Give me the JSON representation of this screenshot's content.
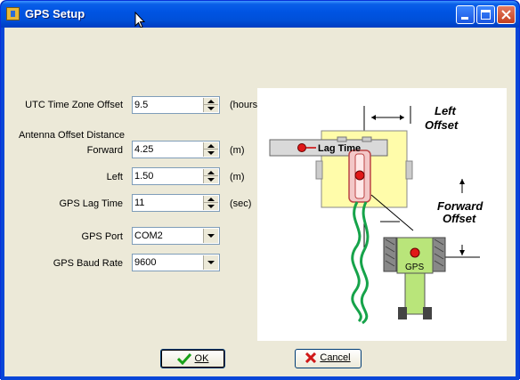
{
  "window": {
    "title": "GPS Setup",
    "minimize_glyph": "_",
    "maximize_glyph": "□",
    "close_glyph": "✕"
  },
  "form": {
    "utc_label": "UTC Time Zone Offset",
    "utc_value": "9.5",
    "utc_unit": "(hours)",
    "antenna_heading": "Antenna Offset Distance",
    "forward_label": "Forward",
    "forward_value": "4.25",
    "forward_unit": "(m)",
    "left_label": "Left",
    "left_value": "1.50",
    "left_unit": "(m)",
    "lag_label": "GPS Lag Time",
    "lag_value": "11",
    "lag_unit": "(sec)",
    "port_label": "GPS Port",
    "port_value": "COM2",
    "baud_label": "GPS Baud Rate",
    "baud_value": "9600"
  },
  "diagram": {
    "left_offset_line1": "Left",
    "left_offset_line2": "Offset",
    "lag_time": "Lag Time",
    "forward_offset_line1": "Forward",
    "forward_offset_line2": "Offset",
    "gps": "GPS"
  },
  "buttons": {
    "ok": "OK",
    "cancel": "Cancel"
  },
  "icons": {
    "ok": "check-icon",
    "cancel": "x-icon"
  }
}
